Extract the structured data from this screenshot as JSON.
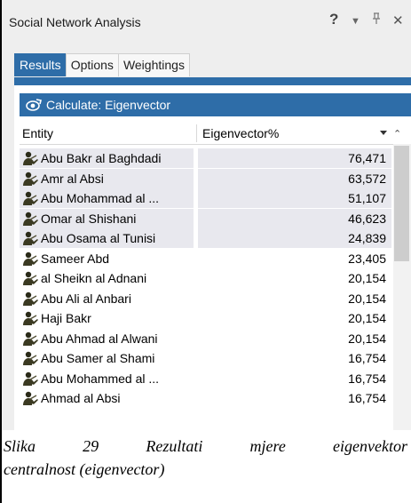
{
  "panel": {
    "title": "Social Network Analysis",
    "help_icon": "?",
    "tabs": [
      {
        "label": "Results",
        "active": true
      },
      {
        "label": "Options",
        "active": false
      },
      {
        "label": "Weightings",
        "active": false
      }
    ],
    "calculate_label": "Calculate: Eigenvector",
    "accent_color": "#2e6da8"
  },
  "grid": {
    "columns": [
      "Entity",
      "Eigenvector%"
    ],
    "rows": [
      {
        "entity": "Abu Bakr al Baghdadi",
        "value": "76,471",
        "selected": true
      },
      {
        "entity": "Amr al Absi",
        "value": "63,572",
        "selected": true
      },
      {
        "entity": "Abu Mohammad al ...",
        "value": "51,107",
        "selected": true
      },
      {
        "entity": "Omar al Shishani",
        "value": "46,623",
        "selected": true
      },
      {
        "entity": "Abu Osama al Tunisi",
        "value": "24,839",
        "selected": true
      },
      {
        "entity": "Sameer Abd",
        "value": "23,405",
        "selected": false
      },
      {
        "entity": "al Sheikn al Adnani",
        "value": "20,154",
        "selected": false
      },
      {
        "entity": "Abu Ali al Anbari",
        "value": "20,154",
        "selected": false
      },
      {
        "entity": "Haji Bakr",
        "value": "20,154",
        "selected": false
      },
      {
        "entity": "Abu Ahmad al Alwani",
        "value": "20,154",
        "selected": false
      },
      {
        "entity": "Abu Samer al Shami",
        "value": "16,754",
        "selected": false
      },
      {
        "entity": "Abu Mohammed al ...",
        "value": "16,754",
        "selected": false
      },
      {
        "entity": "Ahmad al Absi",
        "value": "16,754",
        "selected": false
      }
    ]
  },
  "caption": {
    "words": [
      "Slika",
      "29",
      "Rezultati",
      "mjere",
      "eigenvektor"
    ],
    "line2": "centralnost (eigenvector)"
  }
}
